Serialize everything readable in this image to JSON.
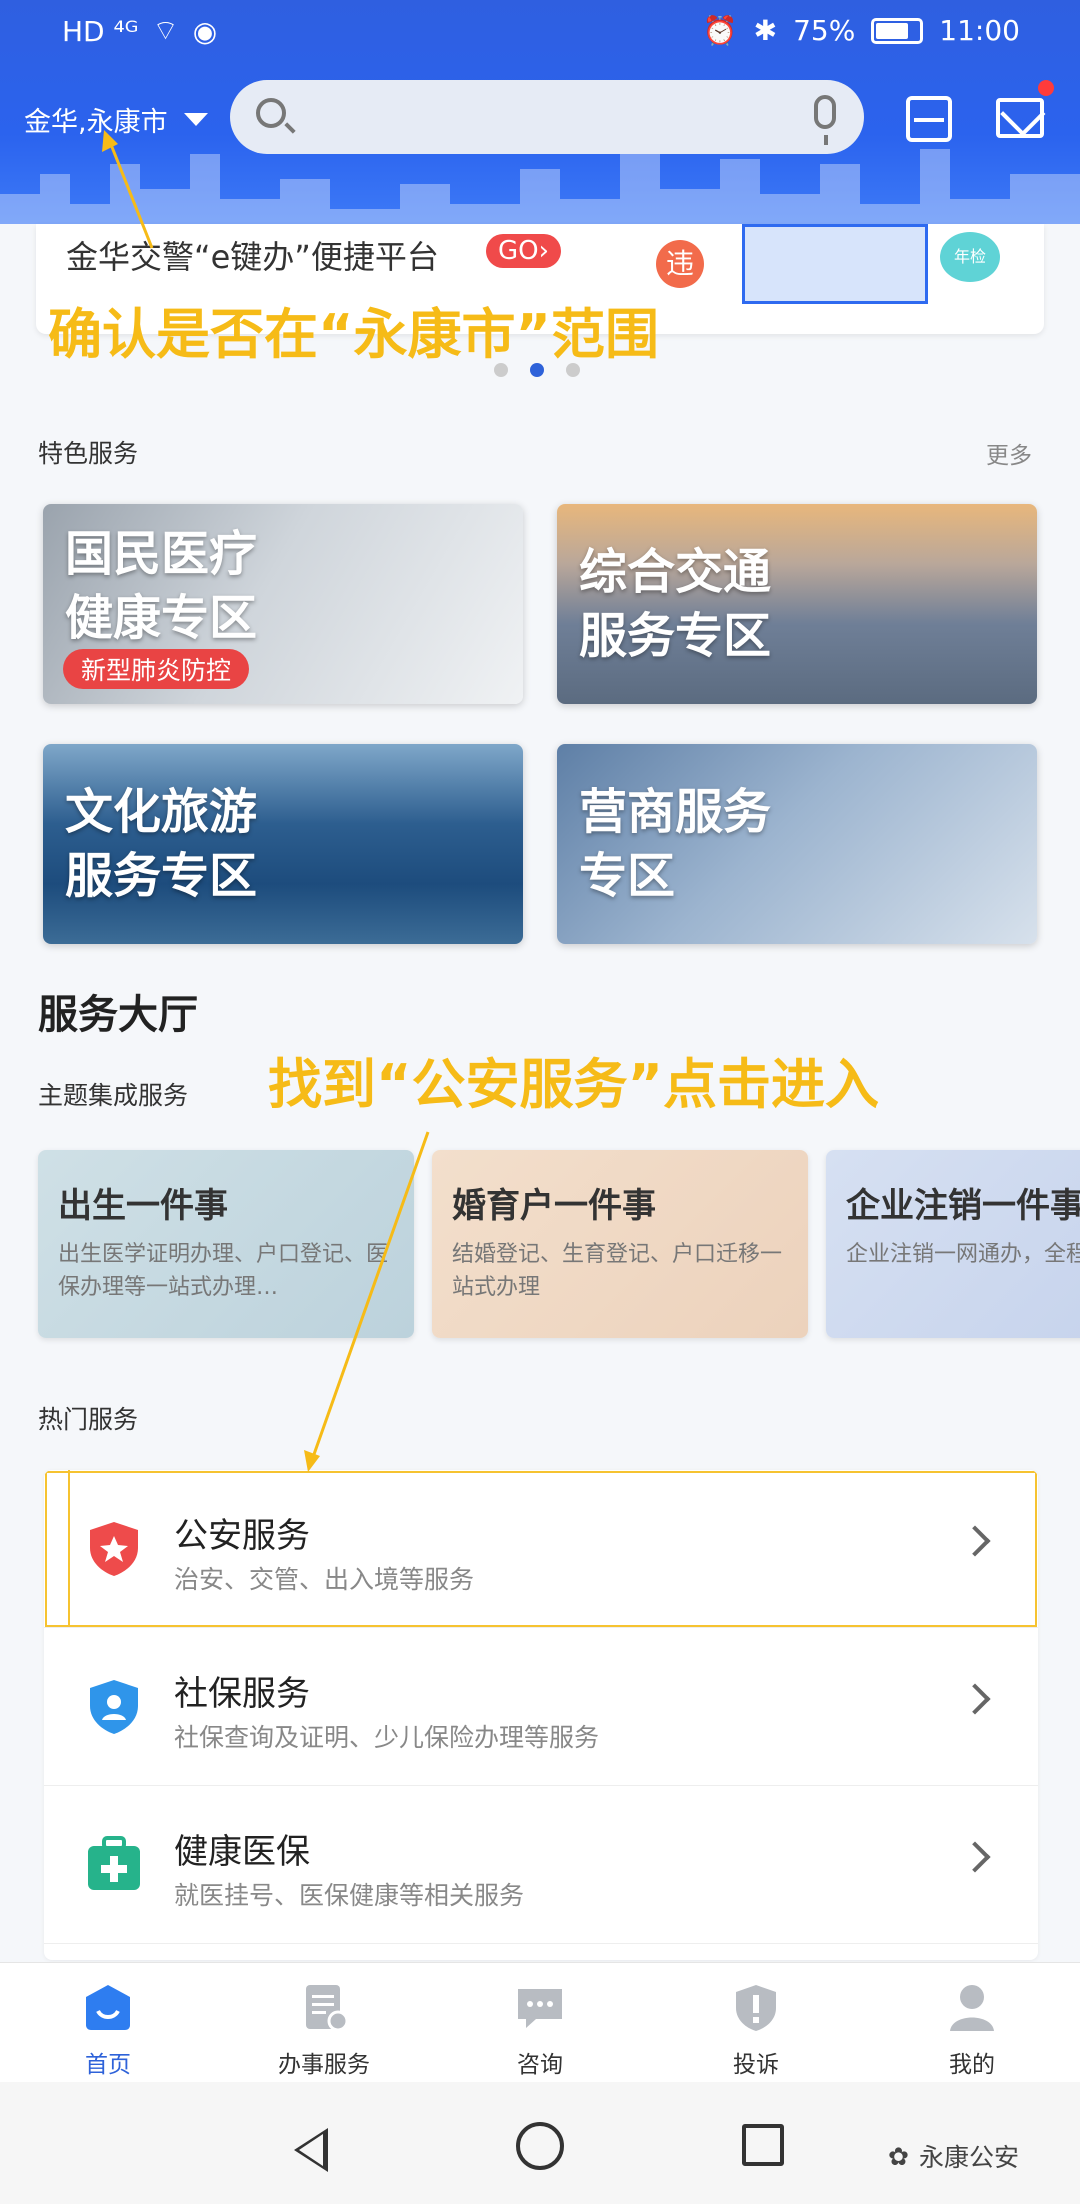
{
  "status_bar": {
    "left": "HD ⁴ᴳ",
    "battery": "75%",
    "time": "11:00"
  },
  "header": {
    "city": "金华,永康市"
  },
  "banner": {
    "text": "金华交警“e键办”便捷平台",
    "go": "GO›",
    "badge": "违",
    "annual": "年检"
  },
  "carousel": {
    "active_index": 1,
    "count": 3
  },
  "special_services": {
    "title": "特色服务",
    "more": "更多",
    "tiles": [
      {
        "line1": "国民医疗",
        "line2": "健康专区",
        "badge": "新型肺炎防控"
      },
      {
        "line1": "综合交通",
        "line2": "服务专区"
      },
      {
        "line1": "文化旅游",
        "line2": "服务专区"
      },
      {
        "line1": "营商服务",
        "line2": "专区"
      }
    ]
  },
  "service_hall": {
    "title": "服务大厅",
    "theme_title": "主题集成服务",
    "theme_cards": [
      {
        "title": "出生一件事",
        "desc": "出生医学证明办理、户口登记、医保办理等一站式办理…"
      },
      {
        "title": "婚育户一件事",
        "desc": "结婚登记、生育登记、户口迁移一站式办理"
      },
      {
        "title": "企业注销一件事",
        "desc": "企业注销一网通办，全程跑一次"
      }
    ]
  },
  "hot_services": {
    "title": "热门服务",
    "items": [
      {
        "title": "公安服务",
        "desc": "治安、交管、出入境等服务"
      },
      {
        "title": "社保服务",
        "desc": "社保查询及证明、少儿保险办理等服务"
      },
      {
        "title": "健康医保",
        "desc": "就医挂号、医保健康等相关服务"
      }
    ]
  },
  "bottom_nav": [
    {
      "label": "首页"
    },
    {
      "label": "办事服务"
    },
    {
      "label": "咨询"
    },
    {
      "label": "投诉"
    },
    {
      "label": "我的"
    }
  ],
  "annotations": {
    "note1": "确认是否在“永康市”范围",
    "note2": "找到“公安服务”点击进入"
  },
  "watermark": "永康公安",
  "colors": {
    "accent": "#2e62d9",
    "annotation": "#f6bb17",
    "header": "#2b63ee"
  }
}
